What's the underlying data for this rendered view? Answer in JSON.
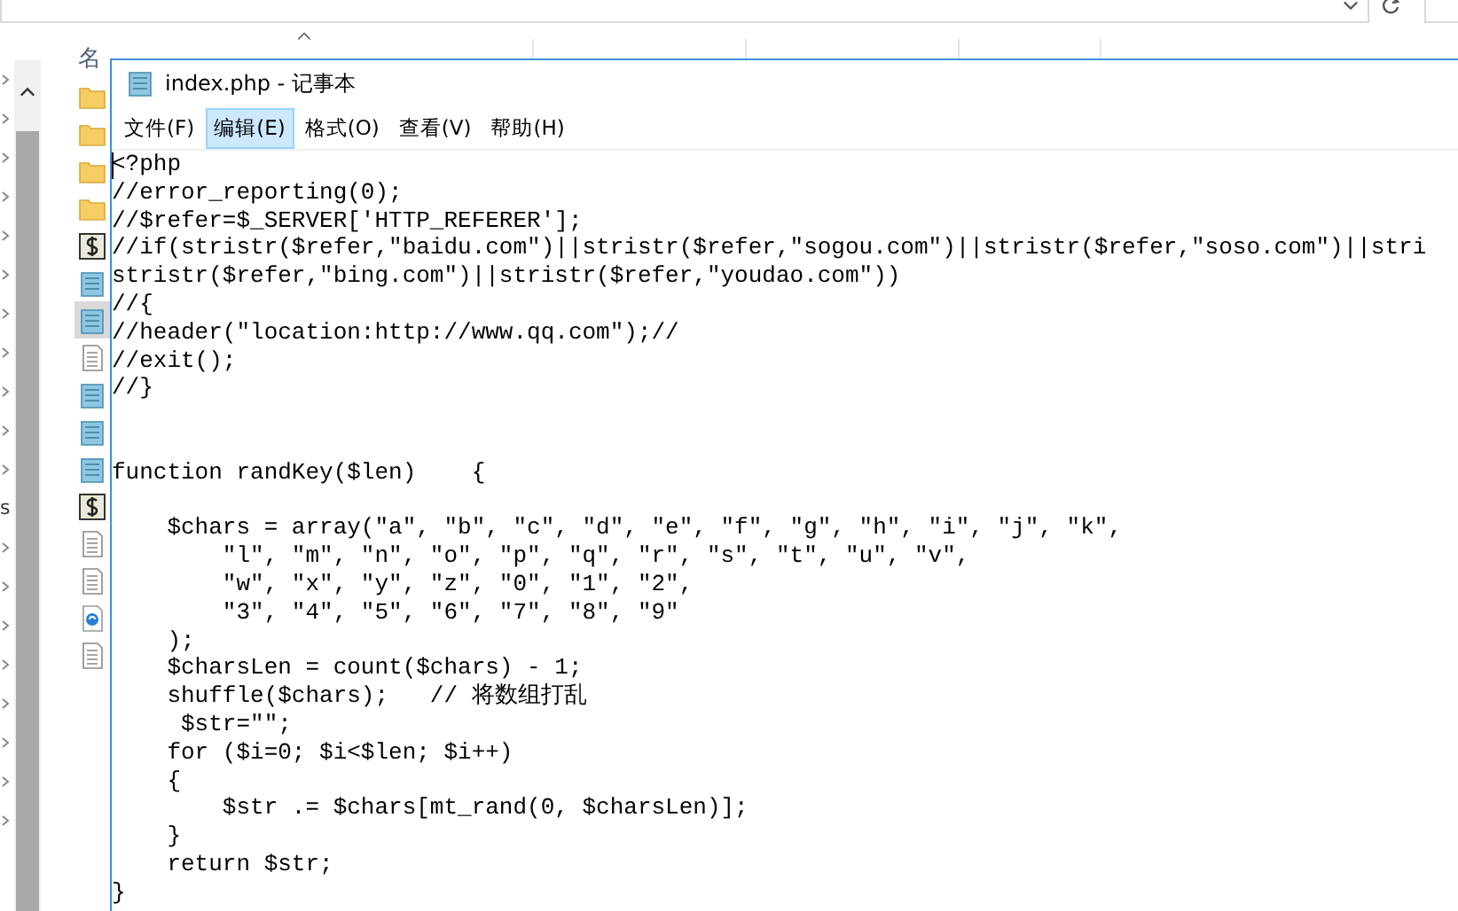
{
  "explorer": {
    "header": {
      "name_column": "名"
    },
    "files": [
      {
        "kind": "folder",
        "selected": false
      },
      {
        "kind": "folder",
        "selected": false
      },
      {
        "kind": "folder",
        "selected": false
      },
      {
        "kind": "folder",
        "selected": false
      },
      {
        "kind": "php",
        "selected": false
      },
      {
        "kind": "notepad",
        "selected": false
      },
      {
        "kind": "notepad",
        "selected": true
      },
      {
        "kind": "text",
        "selected": false
      },
      {
        "kind": "notepad",
        "selected": false
      },
      {
        "kind": "notepad",
        "selected": false
      },
      {
        "kind": "notepad",
        "selected": false
      },
      {
        "kind": "php",
        "selected": false
      },
      {
        "kind": "text",
        "selected": false
      },
      {
        "kind": "text",
        "selected": false
      },
      {
        "kind": "web",
        "selected": false
      },
      {
        "kind": "text",
        "selected": false
      }
    ],
    "nav_label": "s"
  },
  "window": {
    "title": "index.php - 记事本",
    "menu": [
      {
        "label": "文件(F)",
        "selected": false
      },
      {
        "label": "编辑(E)",
        "selected": true
      },
      {
        "label": "格式(O)",
        "selected": false
      },
      {
        "label": "查看(V)",
        "selected": false
      },
      {
        "label": "帮助(H)",
        "selected": false
      }
    ],
    "code_lines": [
      {
        "kind": "code",
        "text": "<?php"
      },
      {
        "kind": "code",
        "text": "//error_reporting(0);"
      },
      {
        "kind": "code",
        "text": "//$refer=$_SERVER['HTTP_REFERER'];"
      },
      {
        "kind": "code",
        "text": "//if(stristr($refer,\"baidu.com\")||stristr($refer,\"sogou.com\")||stristr($refer,\"soso.com\")||stri"
      },
      {
        "kind": "code",
        "text": "stristr($refer,\"bing.com\")||stristr($refer,\"youdao.com\"))"
      },
      {
        "kind": "code",
        "text": "//{"
      },
      {
        "kind": "code",
        "text": "//header(\"location:http://www.qq.com\");//"
      },
      {
        "kind": "code",
        "text": "//exit();"
      },
      {
        "kind": "code",
        "text": "//}"
      },
      {
        "kind": "blank"
      },
      {
        "kind": "blank"
      },
      {
        "kind": "code",
        "text": "function randKey($len)    {"
      },
      {
        "kind": "blank"
      },
      {
        "kind": "code",
        "text": "    $chars = array(\"a\", \"b\", \"c\", \"d\", \"e\", \"f\", \"g\", \"h\", \"i\", \"j\", \"k\","
      },
      {
        "kind": "code",
        "text": "        \"l\", \"m\", \"n\", \"o\", \"p\", \"q\", \"r\", \"s\", \"t\", \"u\", \"v\","
      },
      {
        "kind": "code",
        "text": "        \"w\", \"x\", \"y\", \"z\", \"0\", \"1\", \"2\","
      },
      {
        "kind": "code",
        "text": "        \"3\", \"4\", \"5\", \"6\", \"7\", \"8\", \"9\""
      },
      {
        "kind": "code",
        "text": "    );"
      },
      {
        "kind": "code",
        "text": "    $charsLen = count($chars) - 1;"
      },
      {
        "kind": "code",
        "text": "    shuffle($chars);   // 将数组打乱"
      },
      {
        "kind": "code",
        "text": "     $str=\"\";"
      },
      {
        "kind": "code",
        "text": "    for ($i=0; $i<$len; $i++)"
      },
      {
        "kind": "code",
        "text": "    {"
      },
      {
        "kind": "code",
        "text": "        $str .= $chars[mt_rand(0, $charsLen)];"
      },
      {
        "kind": "code",
        "text": "    }"
      },
      {
        "kind": "code",
        "text": "    return $str;"
      },
      {
        "kind": "code",
        "text": "}"
      }
    ]
  }
}
